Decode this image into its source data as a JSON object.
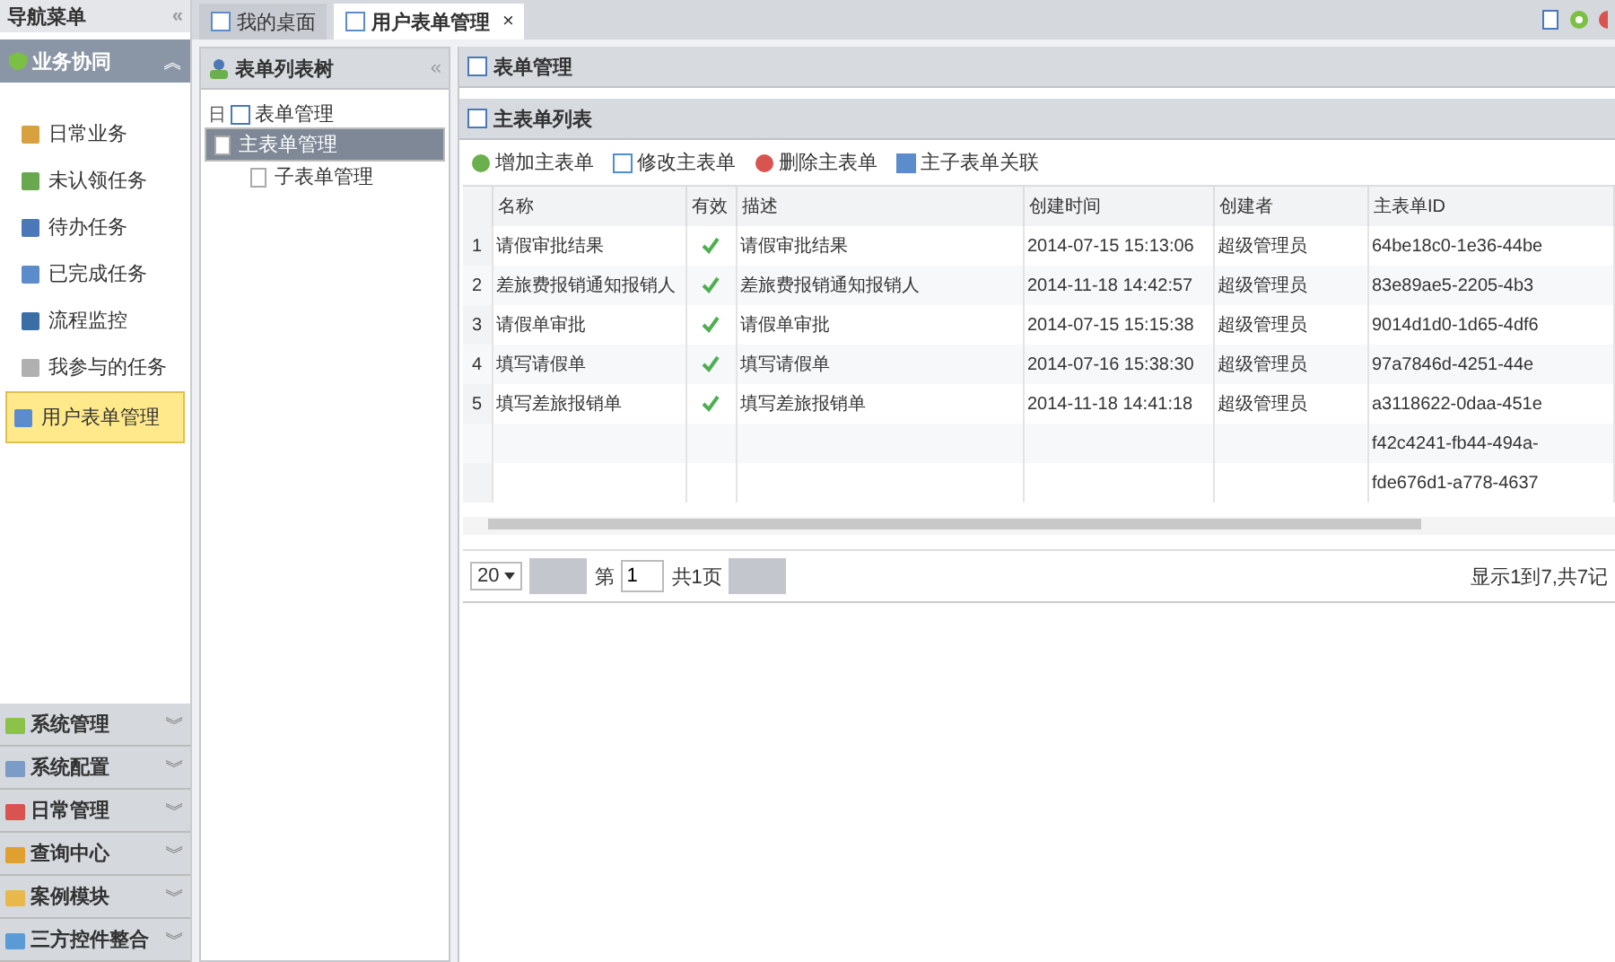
{
  "nav": {
    "title": "导航菜单",
    "collapse": "«",
    "section": {
      "label": "业务协同",
      "toggle": "︽"
    },
    "items": [
      {
        "label": "日常业务",
        "selected": false,
        "color": "#d9a040"
      },
      {
        "label": "未认领任务",
        "selected": false,
        "color": "#6aa84f"
      },
      {
        "label": "待办任务",
        "selected": false,
        "color": "#4a78b8"
      },
      {
        "label": "已完成任务",
        "selected": false,
        "color": "#5b8ccc"
      },
      {
        "label": "流程监控",
        "selected": false,
        "color": "#3a6ea5"
      },
      {
        "label": "我参与的任务",
        "selected": false,
        "color": "#b0b0b0"
      },
      {
        "label": "用户表单管理",
        "selected": true,
        "color": "#5b8ccc"
      }
    ],
    "groups": [
      {
        "label": "系统管理",
        "toggle": "︾",
        "color": "#8bc34a"
      },
      {
        "label": "系统配置",
        "toggle": "︾",
        "color": "#7a9cc6"
      },
      {
        "label": "日常管理",
        "toggle": "︾",
        "color": "#d9534f"
      },
      {
        "label": "查询中心",
        "toggle": "︾",
        "color": "#e0a030"
      },
      {
        "label": "案例模块",
        "toggle": "︾",
        "color": "#e8b84a"
      },
      {
        "label": "三方控件整合",
        "toggle": "︾",
        "color": "#5b9bd5"
      }
    ]
  },
  "tabs": [
    {
      "label": "我的桌面",
      "selected": false
    },
    {
      "label": "用户表单管理",
      "selected": true,
      "close": "×"
    }
  ],
  "tree": {
    "title": "表单列表树",
    "collapse": "«",
    "root": {
      "label": "表单管理",
      "toggle": "日",
      "children": [
        {
          "label": "主表单管理",
          "selected": true
        },
        {
          "label": "子表单管理",
          "selected": false
        }
      ]
    }
  },
  "panel": {
    "title": "表单管理",
    "grid_title": "主表单列表",
    "toolbar": [
      {
        "label": "增加主表单",
        "kind": "add"
      },
      {
        "label": "修改主表单",
        "kind": "edit"
      },
      {
        "label": "删除主表单",
        "kind": "delete"
      },
      {
        "label": "主子表单关联",
        "kind": "link"
      }
    ],
    "columns": [
      "名称",
      "有效",
      "描述",
      "创建时间",
      "创建者",
      "主表单ID"
    ],
    "rows": [
      {
        "num": "1",
        "name": "请假审批结果",
        "valid": true,
        "desc": "请假审批结果",
        "created": "2014-07-15 15:13:06",
        "creator": "超级管理员",
        "id": "64be18c0-1e36-44be"
      },
      {
        "num": "2",
        "name": "差旅费报销通知报销人",
        "valid": true,
        "desc": "差旅费报销通知报销人",
        "created": "2014-11-18 14:42:57",
        "creator": "超级管理员",
        "id": "83e89ae5-2205-4b3"
      },
      {
        "num": "3",
        "name": "请假单审批",
        "valid": true,
        "desc": "请假单审批",
        "created": "2014-07-15 15:15:38",
        "creator": "超级管理员",
        "id": "9014d1d0-1d65-4df6"
      },
      {
        "num": "4",
        "name": "填写请假单",
        "valid": true,
        "desc": "填写请假单",
        "created": "2014-07-16 15:38:30",
        "creator": "超级管理员",
        "id": "97a7846d-4251-44e"
      },
      {
        "num": "5",
        "name": "填写差旅报销单",
        "valid": true,
        "desc": "填写差旅报销单",
        "created": "2014-11-18 14:41:18",
        "creator": "超级管理员",
        "id": "a3118622-0daa-451e"
      },
      {
        "id": "f42c4241-fb44-494a-"
      },
      {
        "id": "fde676d1-a778-4637"
      }
    ],
    "pager": {
      "page_size": "20",
      "page_label": "第",
      "page": "1",
      "total": "共1页",
      "info": "显示1到7,共7记"
    }
  }
}
